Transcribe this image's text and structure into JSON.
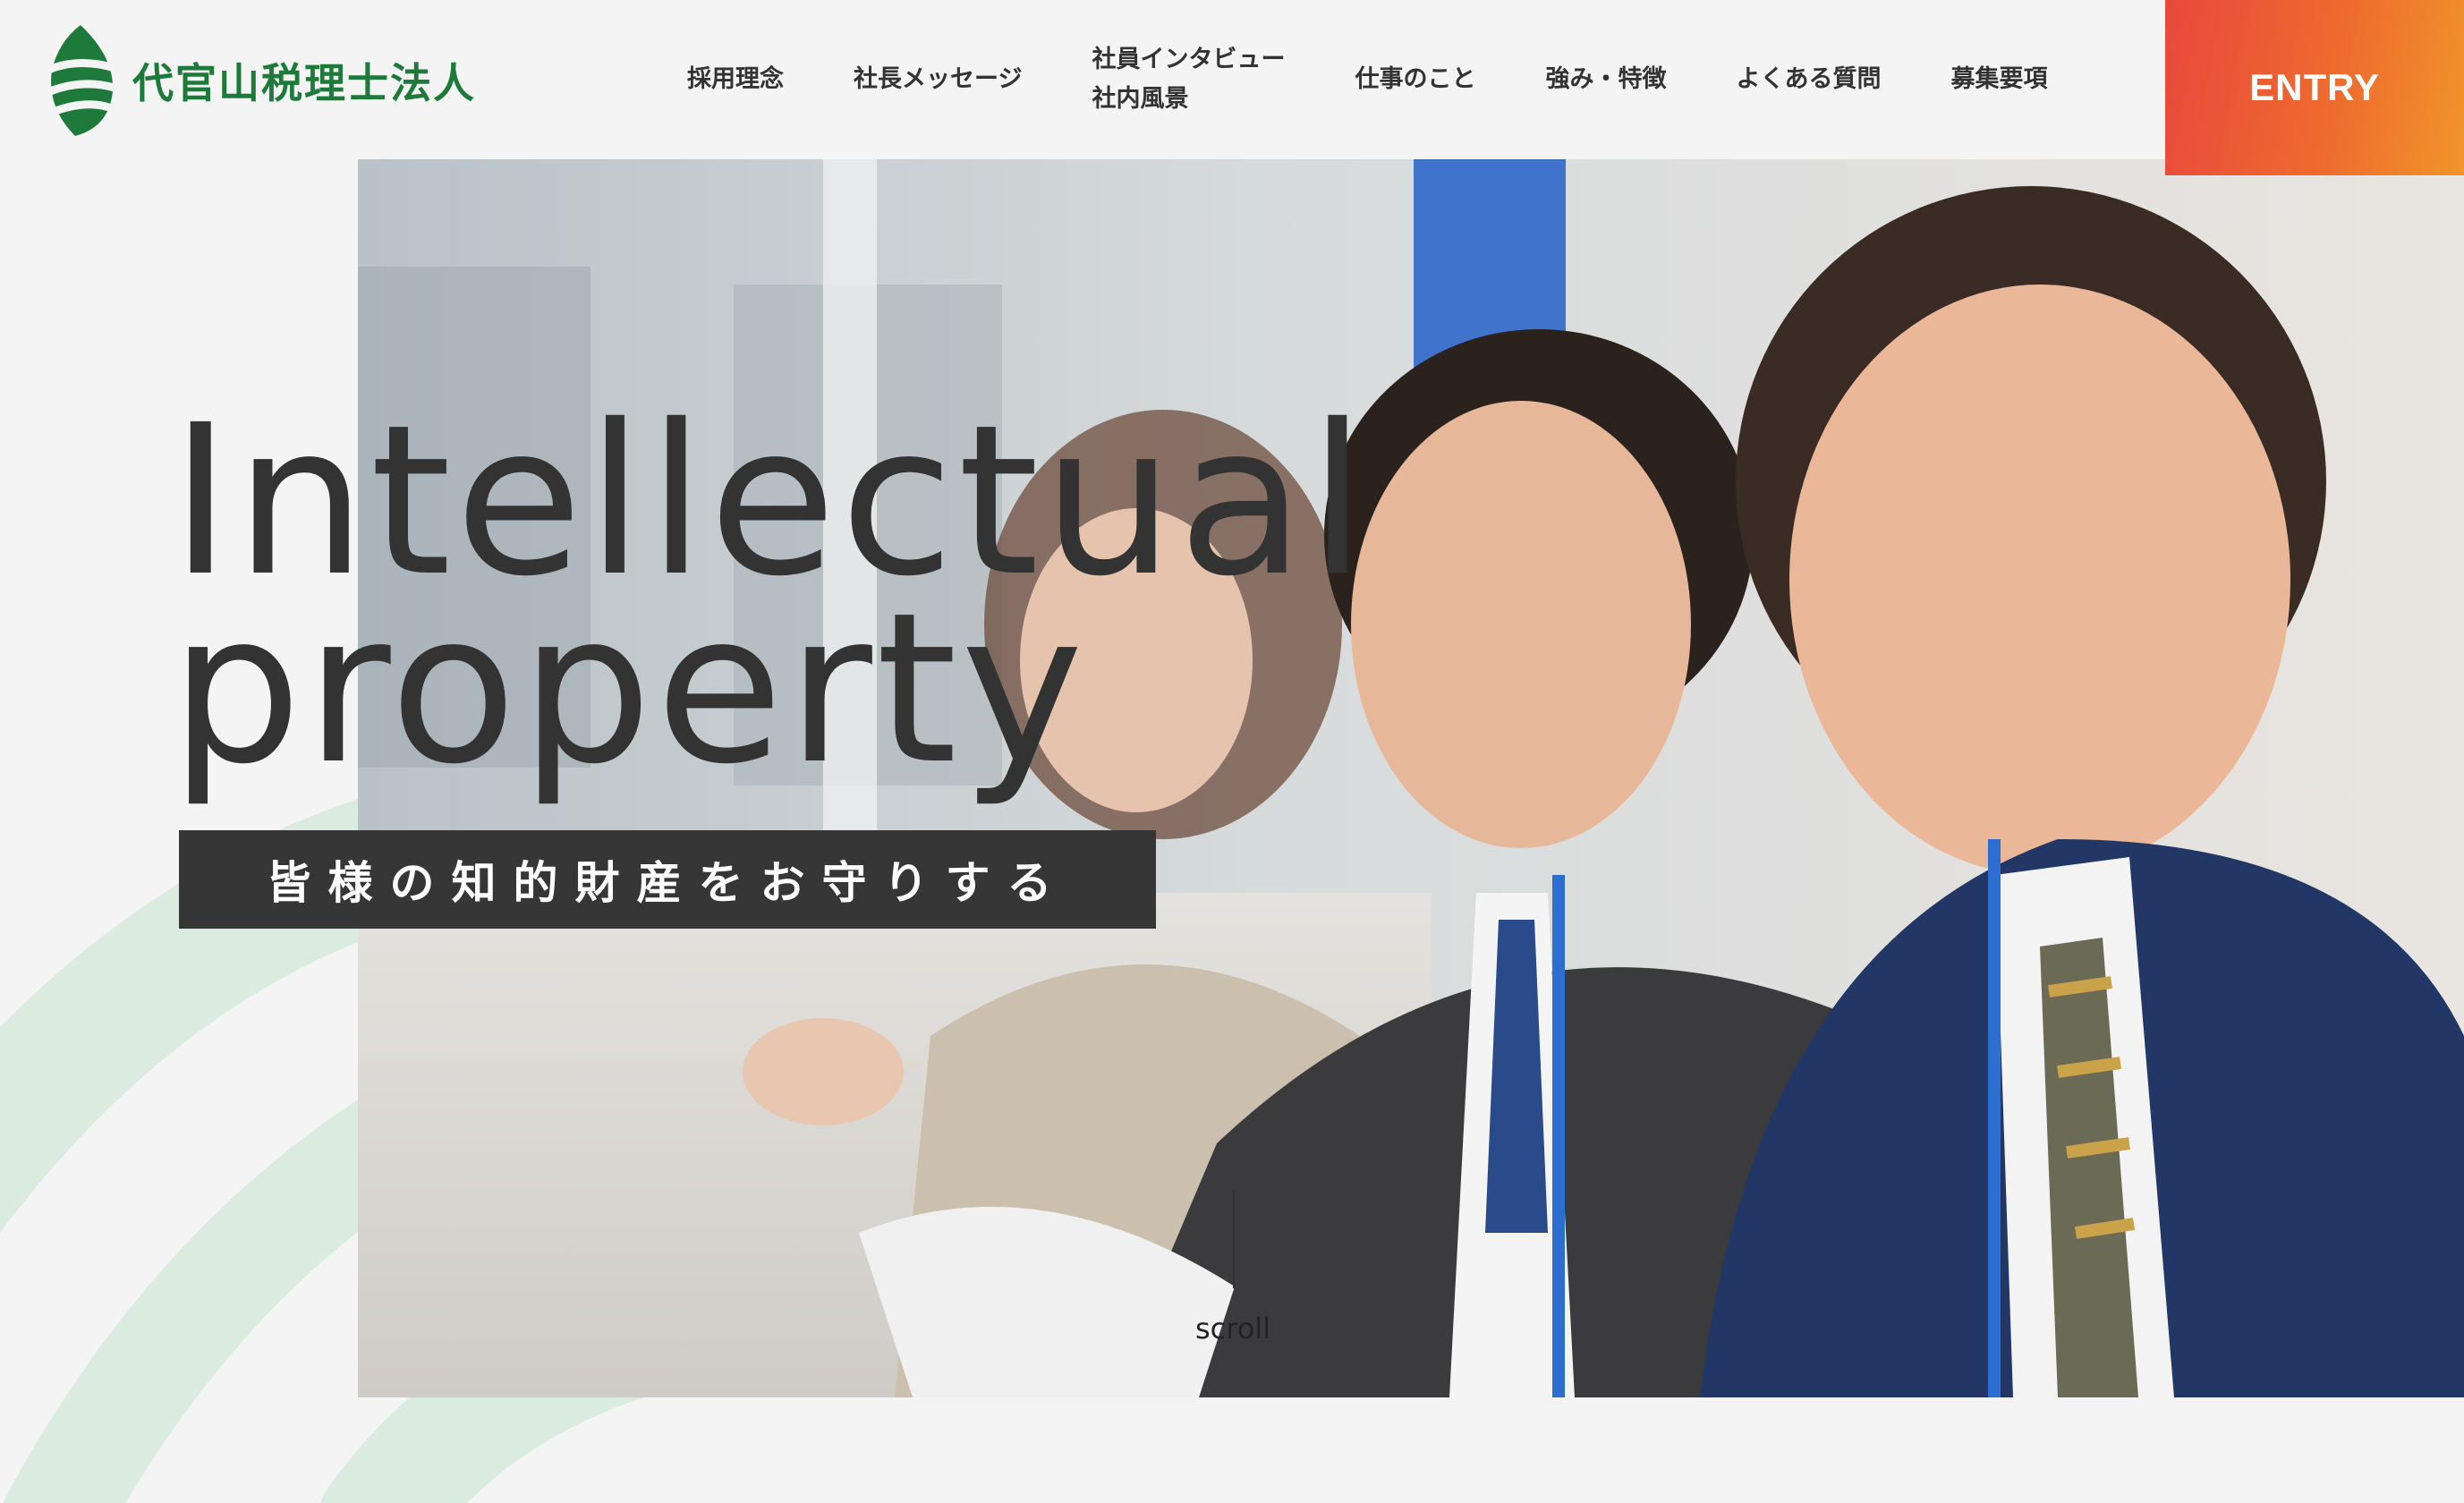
{
  "brand": {
    "name": "代官山税理士法人",
    "logo_icon": "leaf-stripes-icon",
    "color": "#1e7a3a"
  },
  "nav": {
    "items": [
      {
        "label": "採用理念"
      },
      {
        "label": "社長メッセージ"
      },
      {
        "label": "社員インタビュー\n社内風景"
      },
      {
        "label": "仕事のこと"
      },
      {
        "label": "強み・特徴"
      },
      {
        "label": "よくある質問"
      },
      {
        "label": "募集要項"
      }
    ]
  },
  "entry": {
    "label": "ENTRY",
    "gradient_start": "#e8483d",
    "gradient_end": "#f0952a"
  },
  "hero": {
    "title_line1": "Intellectual",
    "title_line2": "property",
    "subtitle": "皆様の知的財産をお守りする",
    "scroll_label": "scroll",
    "photo": "business-team-smiling-photo"
  }
}
